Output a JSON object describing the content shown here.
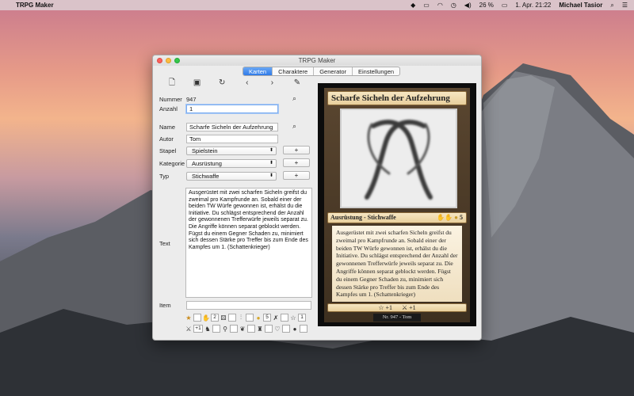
{
  "menubar": {
    "app_name": "TRPG Maker",
    "battery": "26 %",
    "datetime": "1. Apr. 21:22",
    "user": "Michael Tasior"
  },
  "window": {
    "title": "TRPG Maker",
    "tabs": [
      {
        "label": "Karten",
        "active": true
      },
      {
        "label": "Charaktere",
        "active": false
      },
      {
        "label": "Generator",
        "active": false
      },
      {
        "label": "Einstellungen",
        "active": false
      }
    ]
  },
  "toolbar": {
    "icons": [
      "new-document-icon",
      "save-icon",
      "refresh-icon",
      "previous-icon",
      "next-icon",
      "edit-icon"
    ]
  },
  "form": {
    "nummer_label": "Nummer",
    "nummer_value": "947",
    "anzahl_label": "Anzahl",
    "anzahl_value": "1",
    "name_label": "Name",
    "name_value": "Scharfe Sicheln der Aufzehrung",
    "autor_label": "Autor",
    "autor_value": "Tom",
    "stapel_label": "Stapel",
    "stapel_value": "Spielstein",
    "kategorie_label": "Kategorie",
    "kategorie_value": "Ausrüstung",
    "typ_label": "Typ",
    "typ_value": "Stichwaffe",
    "plus_label": "+",
    "text_label": "Text",
    "text_value": "Ausgerüstet mit zwei scharfen Sicheln greifst du zweimal pro Kampfrunde an. Sobald einer der beiden TW Würfe gewonnen ist, erhälst du die Initiative. Du schlägst entsprechend der Anzahl der gewonnenen Trefferwürfe jeweils separat zu. Die Angriffe können separat geblockt werden. Fügst du einem Gegner Schaden zu, minimiert sich dessen Stärke pro Treffer bis zum Ende des Kampfes um 1.   (Schattenkrieger)",
    "item_label": "Item",
    "item_value": ""
  },
  "attributes": {
    "row1": [
      {
        "icon": "star-icon",
        "glyph": "★",
        "value": ""
      },
      {
        "icon": "hand-icon",
        "glyph": "✋",
        "value": "2"
      },
      {
        "icon": "dice-icon",
        "glyph": "⚄",
        "value": ""
      },
      {
        "icon": "chart-icon",
        "glyph": "⫶",
        "value": ""
      },
      {
        "icon": "coin-icon",
        "glyph": "●",
        "value": "5"
      },
      {
        "icon": "cross-icon",
        "glyph": "✗",
        "value": ""
      },
      {
        "icon": "star-outline-icon",
        "glyph": "☆",
        "value": "1"
      }
    ],
    "row2": [
      {
        "icon": "crossed-swords-icon",
        "glyph": "⚔",
        "value": "+1"
      },
      {
        "icon": "boot-icon",
        "glyph": "♞",
        "value": ""
      },
      {
        "icon": "dagger-icon",
        "glyph": "⚲",
        "value": ""
      },
      {
        "icon": "wing-icon",
        "glyph": "❦",
        "value": ""
      },
      {
        "icon": "shirt-icon",
        "glyph": "♜",
        "value": ""
      },
      {
        "icon": "heart-icon",
        "glyph": "♡",
        "value": ""
      },
      {
        "icon": "bomb-icon",
        "glyph": "●",
        "value": ""
      }
    ]
  },
  "card": {
    "title": "Scharfe Sicheln der Aufzehrung",
    "type_line": "Ausrüstung - Stichwaffe",
    "type_stats": "5",
    "text": "Ausgerüstet mit zwei scharfen Sicheln greifst du zweimal pro Kampfrunde an. Sobald einer der beiden TW Würfe gewonnen ist, erhälst du die Initiative. Du schlägst entsprechend der Anzahl der gewonnenen Trefferwürfe jeweils separat zu. Die Angriffe können separat geblockt werden. Fügst du einem Gegner Schaden zu, minimiert sich dessen Stärke pro Treffer bis zum Ende des Kampfes um 1. (Schattenkrieger)",
    "bonus_star": "+1",
    "bonus_swords": "+1",
    "footer": "Nr. 947 - Tom"
  }
}
